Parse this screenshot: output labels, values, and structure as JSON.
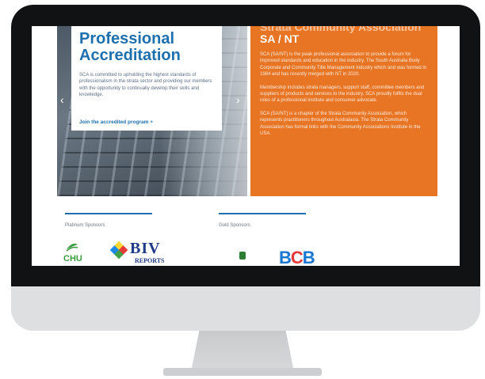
{
  "hero": {
    "title_line1": "Professional",
    "title_line2": "Accreditation",
    "description": "SCA is committed to upholding the highest standards of professionalism in the strata sector and providing our members with the opportunity to continually develop their skills and knowledge.",
    "link_label": "Join the accredited program +"
  },
  "about": {
    "org_name": "Strata Community Association",
    "region_code": "SA / NT",
    "paragraphs": [
      "SCA (SA/NT) is the peak professional association to provide a forum for improved standards and education in the industry. The South Australia Body Corporate and Community Title Management industry which and was formed in 1984 and has recently merged with NT in 2020.",
      "Membership includes strata managers, support staff, committee members and suppliers of products and services to the industry. SCA proudly fulfils the dual roles of a professional institute and consumer advocate.",
      "SCA (SA/NT) is a chapter of the Strata Community Association, which represents practitioners throughout Australasia. The Strata Community Association has formal links with the Community Associations Institute in the USA."
    ]
  },
  "sponsors": {
    "platinum_label": "Platinum Sponsors",
    "gold_label": "Gold Sponsors",
    "logos": {
      "chu": "CHU",
      "biv": "BIV",
      "biv_sub": "REPORTS",
      "bcb": {
        "b1": "B",
        "c": "C",
        "b2": "B"
      }
    }
  },
  "colors": {
    "brand_blue": "#1d6fae",
    "orange": "#e87524"
  }
}
